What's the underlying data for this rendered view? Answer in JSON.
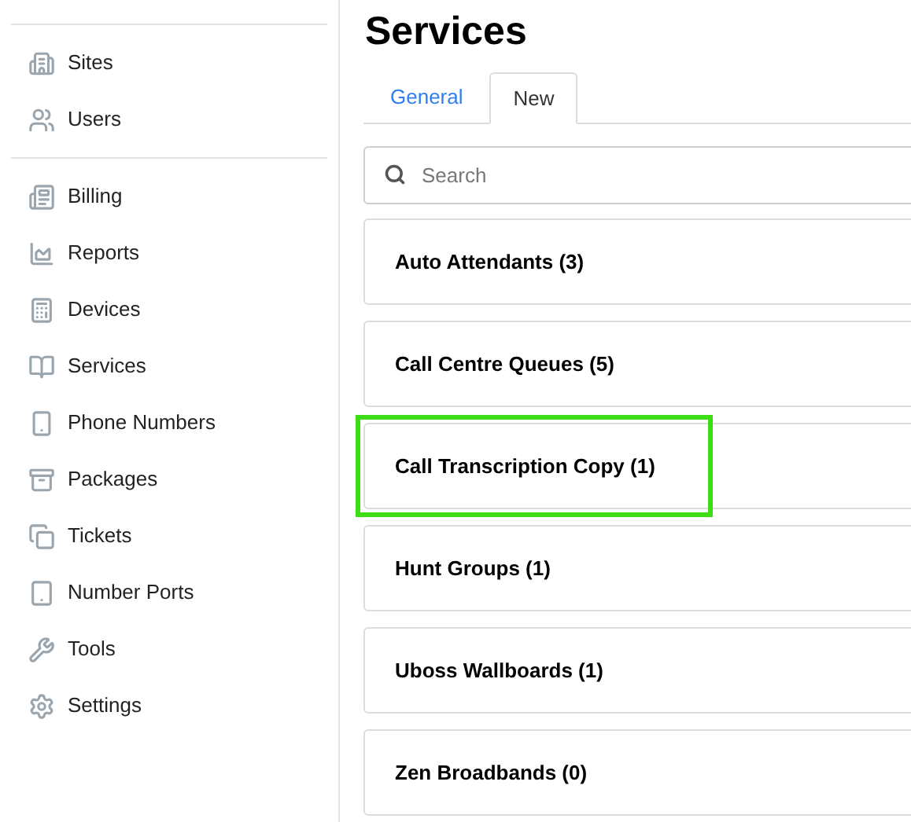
{
  "sidebar": {
    "groups": [
      [
        {
          "label": "Sites"
        },
        {
          "label": "Users"
        }
      ],
      [
        {
          "label": "Billing"
        },
        {
          "label": "Reports"
        },
        {
          "label": "Devices"
        },
        {
          "label": "Services"
        },
        {
          "label": "Phone Numbers"
        },
        {
          "label": "Packages"
        },
        {
          "label": "Tickets"
        },
        {
          "label": "Number Ports"
        },
        {
          "label": "Tools"
        },
        {
          "label": "Settings"
        }
      ]
    ]
  },
  "page_title": "Services",
  "tabs": [
    {
      "label": "General",
      "selected": false
    },
    {
      "label": "New",
      "selected": true
    }
  ],
  "search": {
    "placeholder": "Search"
  },
  "services": [
    {
      "label": "Auto Attendants (3)",
      "highlighted": false
    },
    {
      "label": "Call Centre Queues (5)",
      "highlighted": false
    },
    {
      "label": "Call Transcription Copy (1)",
      "highlighted": true
    },
    {
      "label": "Hunt Groups (1)",
      "highlighted": false
    },
    {
      "label": "Uboss Wallboards (1)",
      "highlighted": false
    },
    {
      "label": "Zen Broadbands (0)",
      "highlighted": false
    }
  ]
}
